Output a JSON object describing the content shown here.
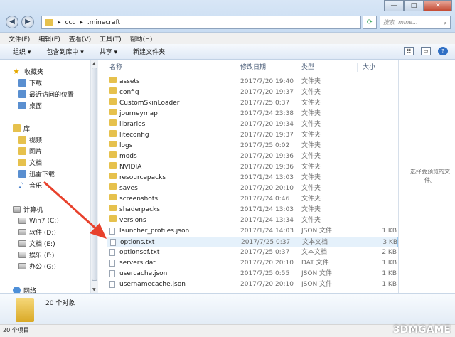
{
  "address": {
    "segments": [
      "ccc",
      ".minecraft"
    ],
    "search_placeholder": "搜索 .mine..."
  },
  "menu": [
    "文件(F)",
    "编辑(E)",
    "查看(V)",
    "工具(T)",
    "帮助(H)"
  ],
  "toolbar": {
    "organize": "组织 ▾",
    "include_library": "包含到库中 ▾",
    "share": "共享 ▾",
    "new_folder": "新建文件夹"
  },
  "sidebar": {
    "favorites": "收藏夹",
    "favorites_items": [
      "下载",
      "最近访问的位置",
      "桌面"
    ],
    "libraries": "库",
    "library_items": [
      "视频",
      "图片",
      "文档",
      "迅雷下载",
      "音乐"
    ],
    "computer": "计算机",
    "drives": [
      "Win7 (C:)",
      "软件 (D:)",
      "文档 (E:)",
      "娱乐 (F:)",
      "办公 (G:)"
    ],
    "network": "网络"
  },
  "columns": {
    "name": "名称",
    "date": "修改日期",
    "type": "类型",
    "size": "大小"
  },
  "files": [
    {
      "name": "assets",
      "date": "2017/7/20 19:40",
      "type": "文件夹",
      "size": "",
      "kind": "folder"
    },
    {
      "name": "config",
      "date": "2017/7/20 19:37",
      "type": "文件夹",
      "size": "",
      "kind": "folder"
    },
    {
      "name": "CustomSkinLoader",
      "date": "2017/7/25 0:37",
      "type": "文件夹",
      "size": "",
      "kind": "folder"
    },
    {
      "name": "journeymap",
      "date": "2017/7/24 23:38",
      "type": "文件夹",
      "size": "",
      "kind": "folder"
    },
    {
      "name": "libraries",
      "date": "2017/7/20 19:34",
      "type": "文件夹",
      "size": "",
      "kind": "folder"
    },
    {
      "name": "liteconfig",
      "date": "2017/7/20 19:37",
      "type": "文件夹",
      "size": "",
      "kind": "folder"
    },
    {
      "name": "logs",
      "date": "2017/7/25 0:02",
      "type": "文件夹",
      "size": "",
      "kind": "folder"
    },
    {
      "name": "mods",
      "date": "2017/7/20 19:36",
      "type": "文件夹",
      "size": "",
      "kind": "folder"
    },
    {
      "name": "NVIDIA",
      "date": "2017/7/20 19:36",
      "type": "文件夹",
      "size": "",
      "kind": "folder"
    },
    {
      "name": "resourcepacks",
      "date": "2017/1/24 13:03",
      "type": "文件夹",
      "size": "",
      "kind": "folder"
    },
    {
      "name": "saves",
      "date": "2017/7/20 20:10",
      "type": "文件夹",
      "size": "",
      "kind": "folder"
    },
    {
      "name": "screenshots",
      "date": "2017/7/24 0:46",
      "type": "文件夹",
      "size": "",
      "kind": "folder"
    },
    {
      "name": "shaderpacks",
      "date": "2017/1/24 13:03",
      "type": "文件夹",
      "size": "",
      "kind": "folder"
    },
    {
      "name": "versions",
      "date": "2017/1/24 13:34",
      "type": "文件夹",
      "size": "",
      "kind": "folder"
    },
    {
      "name": "launcher_profiles.json",
      "date": "2017/1/24 14:03",
      "type": "JSON 文件",
      "size": "1 KB",
      "kind": "file"
    },
    {
      "name": "options.txt",
      "date": "2017/7/25 0:37",
      "type": "文本文档",
      "size": "3 KB",
      "kind": "file",
      "selected": true
    },
    {
      "name": "optionsof.txt",
      "date": "2017/7/25 0:37",
      "type": "文本文档",
      "size": "2 KB",
      "kind": "file"
    },
    {
      "name": "servers.dat",
      "date": "2017/7/20 20:10",
      "type": "DAT 文件",
      "size": "1 KB",
      "kind": "file"
    },
    {
      "name": "usercache.json",
      "date": "2017/7/25 0:55",
      "type": "JSON 文件",
      "size": "1 KB",
      "kind": "file"
    },
    {
      "name": "usernamecache.json",
      "date": "2017/7/20 20:10",
      "type": "JSON 文件",
      "size": "1 KB",
      "kind": "file"
    }
  ],
  "preview_text": "选择要预览的文件。",
  "details_count": "20 个对象",
  "status": "20 个项目",
  "watermark": "3DMGAME",
  "colors": {
    "arrow": "#e8412c",
    "selection": "#e5f1fb",
    "folder": "#e6c14d"
  }
}
